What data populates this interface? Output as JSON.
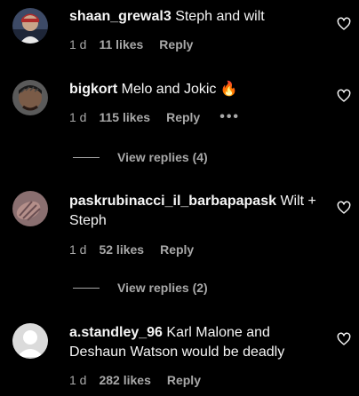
{
  "comments": [
    {
      "username": "shaan_grewal3",
      "text": "Steph and wilt",
      "time": "1 d",
      "likes": "11 likes",
      "reply": "Reply",
      "avatar_icon": "user-photo-avatar",
      "heart_icon": "heart-outline-icon"
    },
    {
      "username": "bigkort",
      "text": "Melo and Jokic 🔥",
      "time": "1 d",
      "likes": "115 likes",
      "reply": "Reply",
      "more_label": "•••",
      "avatar_icon": "user-photo-avatar",
      "heart_icon": "heart-outline-icon",
      "view_replies": "View replies (4)"
    },
    {
      "username": "paskrubinacci_il_barbapapask",
      "text": "Wilt + Steph",
      "time": "1 d",
      "likes": "52 likes",
      "reply": "Reply",
      "avatar_icon": "user-photo-avatar",
      "heart_icon": "heart-outline-icon",
      "view_replies": "View replies (2)"
    },
    {
      "username": "a.standley_96",
      "text": "Karl Malone and Deshaun Watson would be deadly",
      "time": "1 d",
      "likes": "282 likes",
      "reply": "Reply",
      "avatar_icon": "default-avatar",
      "heart_icon": "heart-outline-icon"
    }
  ],
  "colors": {
    "background": "#000000",
    "primary_text": "#f5f5f5",
    "secondary_text": "#a8a8a8"
  }
}
